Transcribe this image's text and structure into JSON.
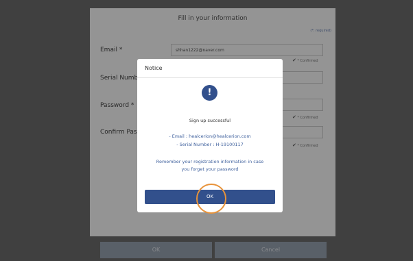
{
  "form": {
    "title": "Fill in your information",
    "required_note": "(*: required)",
    "fields": [
      {
        "label": "Email *",
        "value": "shhan1222@naver.com",
        "check": "* Confirmed"
      },
      {
        "label": "Serial Number",
        "value": "",
        "check": ""
      },
      {
        "label": "Password *",
        "value": "",
        "check": "* Confirmed"
      },
      {
        "label": "Confirm Password",
        "value": "",
        "check": "* Confirmed"
      }
    ],
    "ok_label": "OK",
    "cancel_label": "Cancel"
  },
  "modal": {
    "title": "Notice",
    "icon": "exclamation-icon",
    "icon_glyph": "!",
    "message": "Sign up successful",
    "email_line": "- Email : healcerion@healcerion.com",
    "serial_line": "- Serial Number : H-19100117",
    "reminder_line1": "Remember your registration information in case",
    "reminder_line2": "you forget your password",
    "ok_label": "OK"
  },
  "colors": {
    "accent": "#32508c",
    "highlight_circle": "#e8933a",
    "disabled_button": "#9aa5b3"
  }
}
